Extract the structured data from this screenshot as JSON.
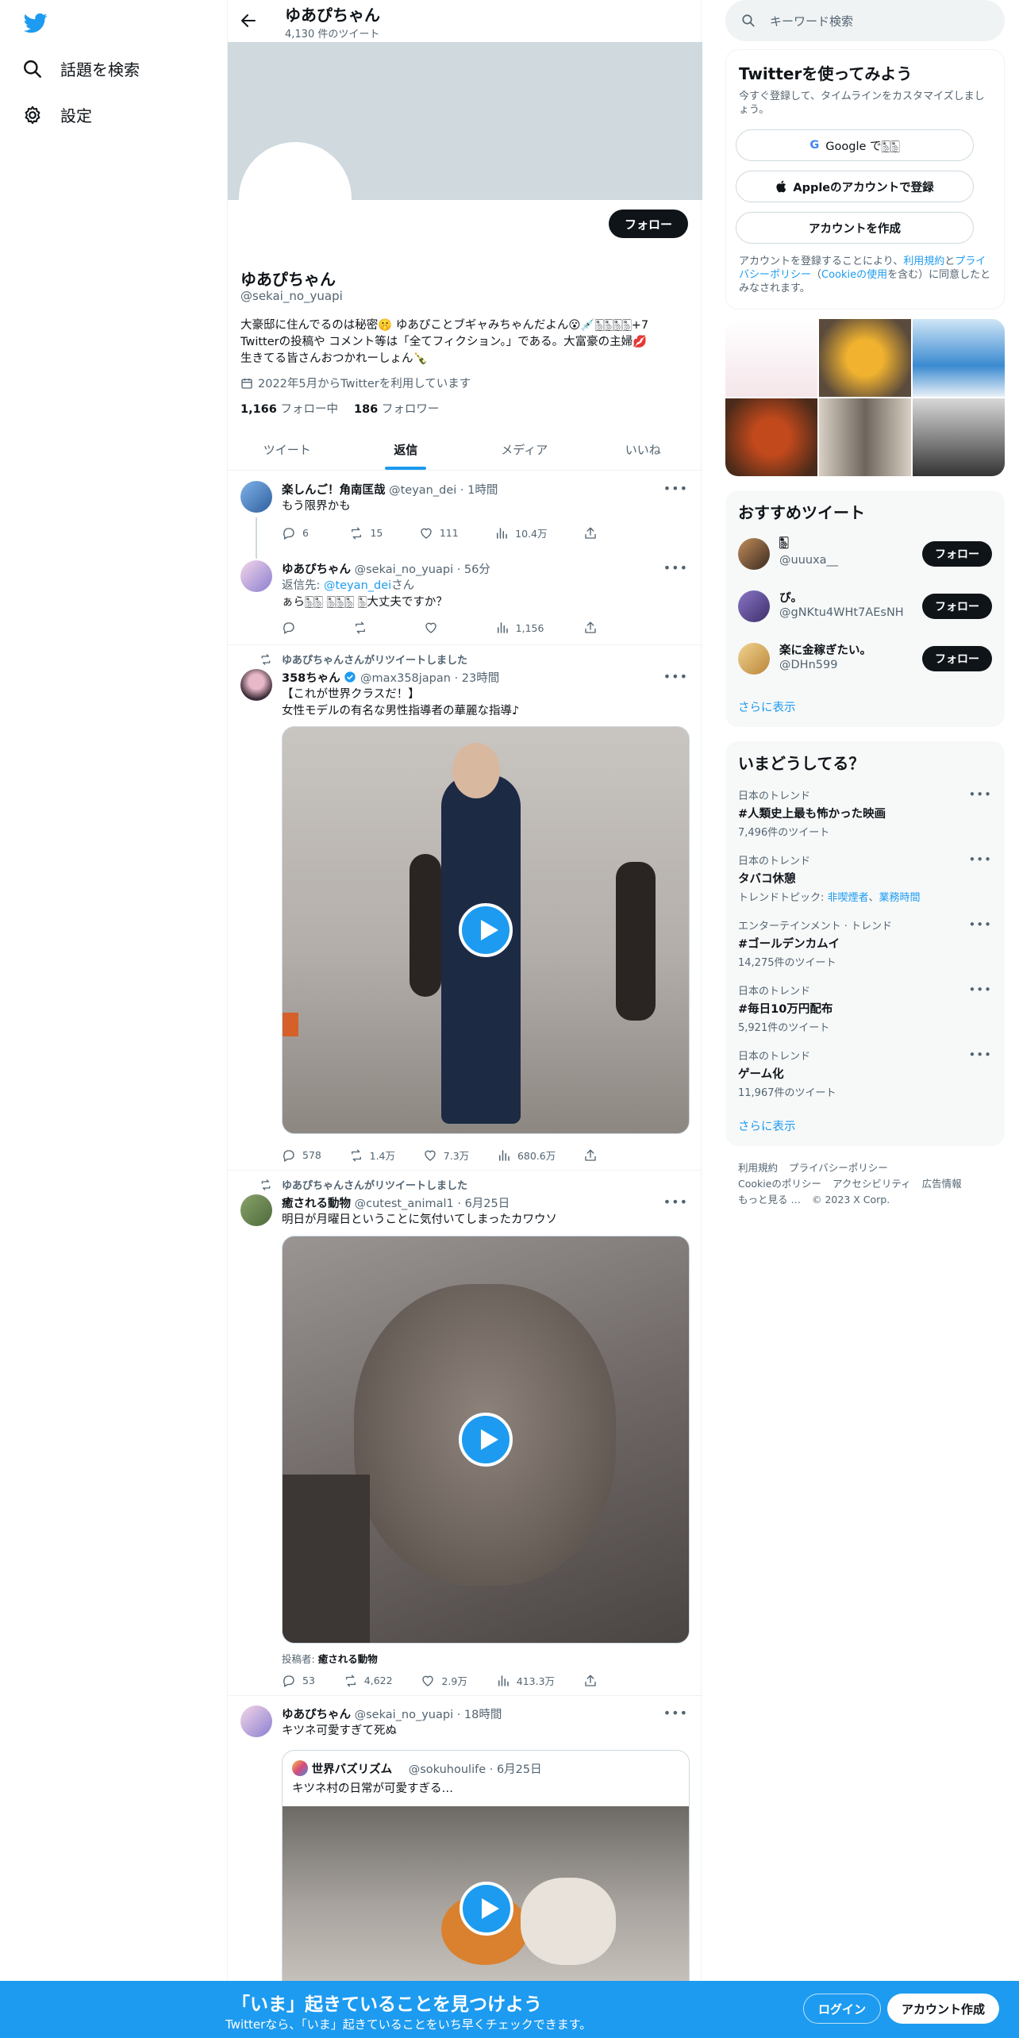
{
  "nav": {
    "explore": "話題を検索",
    "settings": "設定"
  },
  "header": {
    "title": "ゆあぴちゃん",
    "tweet_count": "4,130 件のツイート"
  },
  "profile": {
    "follow": "フォロー",
    "name": "ゆあぴちゃん",
    "handle": "@sekai_no_yuapi",
    "bio_line1": "大豪邸に住んでるのは秘密🤫 ゆあぴことブギャみちゃんだよん😮💉🀢🀢🀢🀢+7",
    "bio_line2": "Twitterの投稿や コメント等は「全てフィクション。」である。大富豪の主婦💋",
    "bio_line3": "生きてる皆さんおつかれーしょん🍾",
    "joined": "2022年5月からTwitterを利用しています",
    "following_count": "1,166",
    "following_label": "フォロー中",
    "followers_count": "186",
    "followers_label": "フォロワー"
  },
  "tabs": [
    "ツイート",
    "返信",
    "メディア",
    "いいね"
  ],
  "tweets": {
    "t1": {
      "name": "楽しんご！角南匡哉",
      "handle": "@teyan_dei",
      "time": "1時間",
      "text": "もう限界かも",
      "reply": "6",
      "rt": "15",
      "like": "111",
      "views": "10.4万"
    },
    "t2": {
      "name": "ゆあぴちゃん",
      "handle": "@sekai_no_yuapi",
      "time": "56分",
      "reply_to_prefix": "返信先: ",
      "reply_to": "@teyan_dei",
      "reply_to_suffix": "さん",
      "text": "ぁら🀢🀢 🀢🀢🀢 🀢大丈夫ですか？",
      "views": "1,156"
    },
    "t3": {
      "rt_label": "ゆあぴちゃんさんがリツイートしました",
      "name": "358ちゃん",
      "handle": "@max358japan",
      "time": "23時間",
      "text1": "【これが世界クラスだ！】",
      "text2": "女性モデルの有名な男性指導者の華麗な指導♪",
      "reply": "578",
      "rt": "1.4万",
      "like": "7.3万",
      "views": "680.6万"
    },
    "t4": {
      "rt_label": "ゆあぴちゃんさんがリツイートしました",
      "name": "癒される動物",
      "handle": "@cutest_animal1",
      "time": "6月25日",
      "text": "明日が月曜日ということに気付いてしまったカワウソ",
      "poster_prefix": "投稿者: ",
      "poster": "癒される動物",
      "reply": "53",
      "rt": "4,622",
      "like": "2.9万",
      "views": "413.3万"
    },
    "t5": {
      "name": "ゆあぴちゃん",
      "handle": "@sekai_no_yuapi",
      "time": "18時間",
      "text": "キツネ可愛すぎて死ぬ",
      "quote_name": "世界バズリズム",
      "quote_handle": "@sokuhoulife",
      "quote_time": "6月25日",
      "quote_text": "キツネ村の日常が可愛すぎる…"
    }
  },
  "right": {
    "search_placeholder": "キーワード検索",
    "signup_title": "Twitterを使ってみよう",
    "signup_sub": "今すぐ登録して、タイムラインをカスタマイズしましょう。",
    "google": "Google で🀢🀢",
    "apple": "Appleのアカウントで登録",
    "create": "アカウントを作成",
    "terms_a": "アカウントを登録することにより、",
    "terms_link1": "利用規約",
    "terms_b": "と",
    "terms_link2": "プライバシーポリシー",
    "terms_c": "（",
    "terms_link3": "Cookieの使用",
    "terms_d": "を含む）に同意したとみなされます。",
    "rec_title": "おすすめツイート",
    "recs": [
      {
        "name": "🀢",
        "handle": "@uuuxa__",
        "btn": "フォロー"
      },
      {
        "name": "ぴ。",
        "handle": "@gNKtu4WHt7AEsNH",
        "btn": "フォロー"
      },
      {
        "name": "楽に金稼ぎたい。",
        "handle": "@DHn599",
        "btn": "フォロー"
      }
    ],
    "show_more": "さらに表示",
    "trends_title": "いまどうしてる？",
    "trends": [
      {
        "cat": "日本のトレンド",
        "title": "#人類史上最も怖かった映画",
        "count": "7,496件のツイート"
      },
      {
        "cat": "日本のトレンド",
        "title": "タバコ休憩",
        "count_prefix": "トレンドトピック: ",
        "topic1": "非喫煙者",
        "topic_sep": "、",
        "topic2": "業務時間"
      },
      {
        "cat": "エンターテインメント · トレンド",
        "title": "#ゴールデンカムイ",
        "count": "14,275件のツイート"
      },
      {
        "cat": "日本のトレンド",
        "title": "#毎日10万円配布",
        "count": "5,921件のツイート"
      },
      {
        "cat": "日本のトレンド",
        "title": "ゲーム化",
        "count": "11,967件のツイート"
      }
    ],
    "footer": [
      "利用規約",
      "プライバシーポリシー",
      "Cookieのポリシー",
      "アクセシビリティ",
      "広告情報",
      "もっと見る …",
      "© 2023 X Corp."
    ]
  },
  "bottom": {
    "title": "「いま」起きていることを見つけよう",
    "sub": "Twitterなら、「いま」起きていることをいち早くチェックできます。",
    "login": "ログイン",
    "signup": "アカウント作成"
  },
  "colors": {
    "accent": "#1d9bf0",
    "dark": "#0f1419",
    "muted": "#536471",
    "banner": "#cfd9de"
  }
}
